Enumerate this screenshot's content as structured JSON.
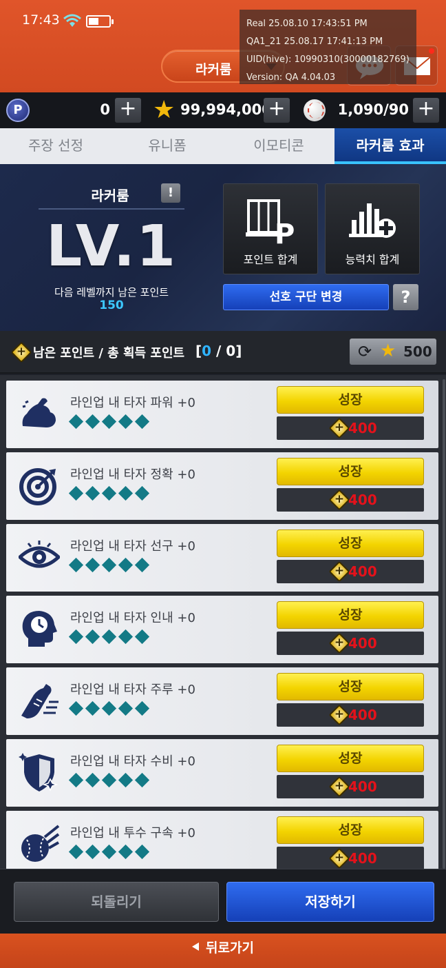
{
  "status": {
    "time": "17:43"
  },
  "header": {
    "room_label": "라커룸"
  },
  "debug": {
    "lines": [
      "Real    25.08.10 17:43:51 PM",
      "QA1_21  25.08.17 17:41:13 PM",
      "UID(hive): 10990310(30000182769)",
      "Version: QA 4.04.03"
    ]
  },
  "currency": {
    "points": "0",
    "stars": "99,994,000",
    "balls": "1,090/90"
  },
  "tabs": [
    {
      "label": "주장 선정",
      "active": false
    },
    {
      "label": "유니폼",
      "active": false
    },
    {
      "label": "이모티콘",
      "active": false
    },
    {
      "label": "라커룸 효과",
      "active": true
    }
  ],
  "level_panel": {
    "title": "라커룸",
    "level": "LV.1",
    "next_label": "다음 레벨까지 남은 포인트",
    "next_value": "150",
    "point_sum_label": "포인트 합계",
    "stat_sum_label": "능력치 합계",
    "preference_button": "선호 구단 변경",
    "help": "?"
  },
  "points_bar": {
    "label": "남은 포인트 / 총 획득 포인트",
    "open": "[",
    "remaining": "0",
    "sep": " / ",
    "total": "0",
    "close": "]",
    "reset_cost": "500"
  },
  "effects": [
    {
      "label": "라인업 내 타자 파워 +0",
      "icon": "muscle-icon",
      "button": "성장",
      "cost": "400",
      "filled": 0
    },
    {
      "label": "라인업 내 타자 정확 +0",
      "icon": "target-icon",
      "button": "성장",
      "cost": "400",
      "filled": 0
    },
    {
      "label": "라인업 내 타자 선구 +0",
      "icon": "eye-icon",
      "button": "성장",
      "cost": "400",
      "filled": 0
    },
    {
      "label": "라인업 내 타자 인내 +0",
      "icon": "head-clock-icon",
      "button": "성장",
      "cost": "400",
      "filled": 0
    },
    {
      "label": "라인업 내 타자 주루 +0",
      "icon": "shoe-icon",
      "button": "성장",
      "cost": "400",
      "filled": 0
    },
    {
      "label": "라인업 내 타자 수비 +0",
      "icon": "shield-icon",
      "button": "성장",
      "cost": "400",
      "filled": 0
    },
    {
      "label": "라인업 내 투수 구속 +0",
      "icon": "fastball-icon",
      "button": "성장",
      "cost": "400",
      "filled": 0
    }
  ],
  "bottom": {
    "undo_label": "되돌리기",
    "save_label": "저장하기",
    "back_label": "뒤로가기"
  },
  "colors": {
    "header_orange": "#d24a21",
    "active_tab_blue": "#1b4fa8",
    "grow_yellow": "#f3d400",
    "cost_red": "#e3121b",
    "dot_teal": "#137a86"
  }
}
